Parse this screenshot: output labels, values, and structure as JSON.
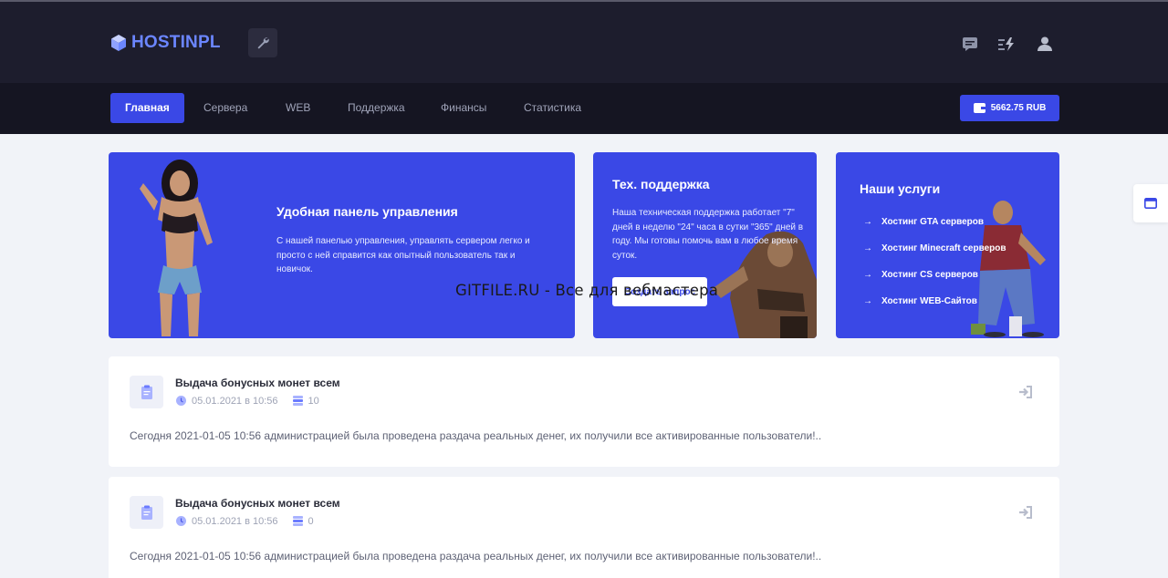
{
  "header": {
    "logo_text": "HOSTINPL",
    "tool_icon": "wrench-icon",
    "icons": [
      "chat-icon",
      "lightning-icon",
      "user-icon"
    ]
  },
  "nav": {
    "items": [
      {
        "label": "Главная",
        "active": true
      },
      {
        "label": "Сервера"
      },
      {
        "label": "WEB"
      },
      {
        "label": "Поддержка"
      },
      {
        "label": "Финансы"
      },
      {
        "label": "Статистика"
      }
    ],
    "balance": "5662.75 RUB"
  },
  "cards": {
    "panel": {
      "title": "Удобная панель управления",
      "text": "С нашей панелью управления, управлять сервером легко и просто с ней справится как опытный пользователь так и новичок."
    },
    "support": {
      "title": "Тех. поддержка",
      "text": "Наша техническая поддержка работает \"7\" дней в неделю \"24\" часа в сутки \"365\" дней в году. Мы готовы помочь вам в любое время суток.",
      "button": "Создать запрос"
    },
    "services": {
      "title": "Наши услуги",
      "items": [
        "Хостинг GTA серверов",
        "Хостинг Minecraft серверов",
        "Хостинг CS серверов",
        "Хостинг WEB-Сайтов"
      ]
    }
  },
  "news": [
    {
      "title": "Выдача бонусных монет всем",
      "date": "05.01.2021 в 10:56",
      "views": "10",
      "text": "Сегодня 2021-01-05 10:56 администрацией была проведена раздача реальных денег, их получили все активированные пользователи!.."
    },
    {
      "title": "Выдача бонусных монет всем",
      "date": "05.01.2021 в 10:56",
      "views": "0",
      "text": "Сегодня 2021-01-05 10:56 администрацией была проведена раздача реальных денег, их получили все активированные пользователи!.."
    }
  ],
  "watermark": "GITFILE.RU - Все для вебмастера",
  "colors": {
    "accent": "#3a48e6",
    "header_bg": "#1d1d2d",
    "nav_bg": "#151522",
    "page_bg": "#f1f3f8",
    "logo": "#6b86ff"
  }
}
